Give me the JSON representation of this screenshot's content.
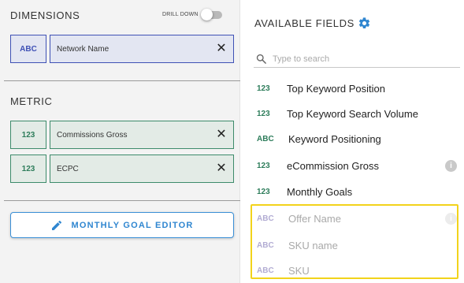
{
  "dimensions": {
    "title": "DIMENSIONS",
    "drill_down_label": "DRILL DOWN",
    "drill_down_on": false,
    "items": [
      {
        "type": "ABC",
        "name": "Network Name"
      }
    ]
  },
  "metric": {
    "title": "METRIC",
    "items": [
      {
        "type": "123",
        "name": "Commissions Gross"
      },
      {
        "type": "123",
        "name": "ECPC"
      }
    ]
  },
  "goal_editor": {
    "label": "MONTHLY GOAL EDITOR",
    "icon": "pencil-icon"
  },
  "available": {
    "title": "AVAILABLE FIELDS",
    "settings_icon": "gear-icon",
    "search": {
      "placeholder": "Type to search",
      "value": ""
    },
    "fields": [
      {
        "type": "123",
        "name": "Top Keyword Position",
        "info": false,
        "disabled": false
      },
      {
        "type": "123",
        "name": "Top Keyword Search Volume",
        "info": false,
        "disabled": false
      },
      {
        "type": "ABC",
        "name": "Keyword Positioning",
        "info": false,
        "disabled": false
      },
      {
        "type": "123",
        "name": "eCommission Gross",
        "info": true,
        "disabled": false
      },
      {
        "type": "123",
        "name": "Monthly Goals",
        "info": false,
        "disabled": false
      },
      {
        "type": "ABC",
        "name": "Offer Name",
        "info": true,
        "disabled": true
      },
      {
        "type": "ABC",
        "name": "SKU name",
        "info": false,
        "disabled": true
      },
      {
        "type": "ABC",
        "name": "SKU",
        "info": false,
        "disabled": true
      }
    ]
  },
  "colors": {
    "dimension_accent": "#3f51b5",
    "metric_accent": "#3d8b6b",
    "button_accent": "#2f86d0",
    "highlight": "#f2d31b"
  }
}
